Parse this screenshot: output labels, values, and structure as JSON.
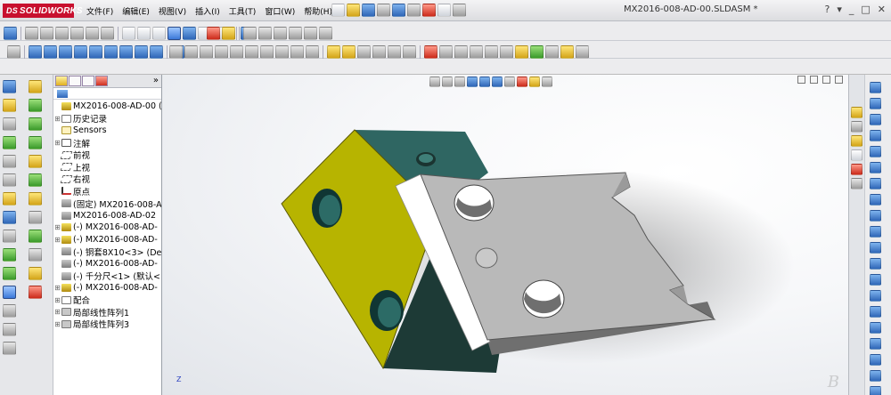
{
  "app": {
    "logo_text": "SOLIDWORKS",
    "logo_prefix": "DS",
    "window_title": "MX2016-008-AD-00.SLDASM *"
  },
  "menu": [
    {
      "label": "文件(F)"
    },
    {
      "label": "编辑(E)"
    },
    {
      "label": "视图(V)"
    },
    {
      "label": "插入(I)"
    },
    {
      "label": "工具(T)"
    },
    {
      "label": "窗口(W)"
    },
    {
      "label": "帮助(H)"
    }
  ],
  "help_icons": [
    "?",
    "▾",
    "_",
    "□",
    "✕"
  ],
  "feature_tree": {
    "items": [
      {
        "label": "MX2016-008-AD-00  (D",
        "icon": "assembly-icon",
        "expand": ""
      },
      {
        "label": "历史记录",
        "icon": "history-icon",
        "expand": "⊞"
      },
      {
        "label": "Sensors",
        "icon": "sensors-icon",
        "expand": ""
      },
      {
        "label": "注解",
        "icon": "annotations-icon",
        "expand": "⊞"
      },
      {
        "label": "前视",
        "icon": "plane-icon",
        "expand": ""
      },
      {
        "label": "上视",
        "icon": "plane-icon",
        "expand": ""
      },
      {
        "label": "右视",
        "icon": "plane-icon",
        "expand": ""
      },
      {
        "label": "原点",
        "icon": "origin-icon",
        "expand": ""
      },
      {
        "label": "(固定) MX2016-008-A",
        "icon": "part-icon",
        "expand": ""
      },
      {
        "label": "MX2016-008-AD-02",
        "icon": "part-icon",
        "expand": ""
      },
      {
        "label": "(-) MX2016-008-AD-",
        "icon": "part-icon",
        "expand": "⊞"
      },
      {
        "label": "(-) MX2016-008-AD-",
        "icon": "part-icon",
        "expand": "⊞"
      },
      {
        "label": "(-) 铜套8X10<3> (De",
        "icon": "part-icon",
        "expand": ""
      },
      {
        "label": "(-) MX2016-008-AD-",
        "icon": "part-icon",
        "expand": ""
      },
      {
        "label": "(-) 千分尺<1> (默认<",
        "icon": "part-icon",
        "expand": ""
      },
      {
        "label": "(-) MX2016-008-AD-",
        "icon": "part-icon",
        "expand": "⊞"
      },
      {
        "label": "配合",
        "icon": "mates-icon",
        "expand": "⊞"
      },
      {
        "label": "局部线性阵列1",
        "icon": "pattern-icon",
        "expand": "⊞"
      },
      {
        "label": "局部线性阵列3",
        "icon": "pattern-icon",
        "expand": "⊞"
      }
    ],
    "collapse_glyph": "»"
  },
  "graphics": {
    "triad_label": "Z",
    "watermark": "B"
  },
  "colors": {
    "block_yellow": "#b7b400",
    "block_teal": "#2f6662",
    "block_dark": "#1d3a36",
    "plate_face": "#b9b9b9",
    "plate_side": "#6f6f6f"
  }
}
